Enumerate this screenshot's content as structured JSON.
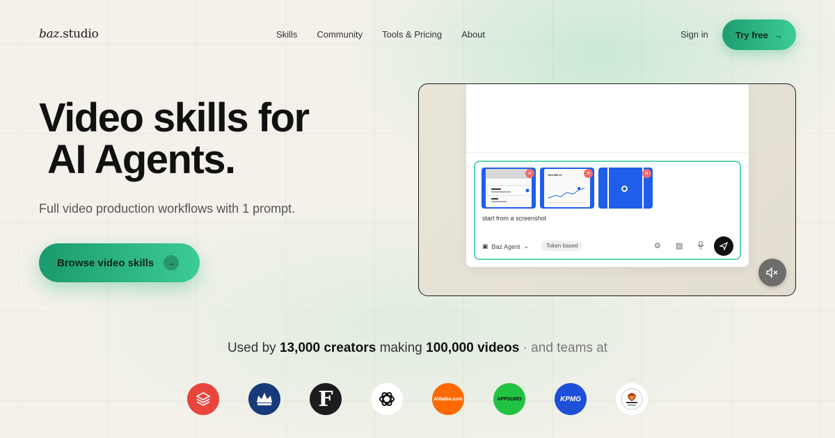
{
  "nav": {
    "logo_brand": "baz",
    "logo_suffix": ".studio",
    "menu": [
      "Skills",
      "Community",
      "Tools & Pricing",
      "About"
    ],
    "sign_in": "Sign in",
    "try_free": "Try free",
    "try_free_arrow": "→"
  },
  "hero": {
    "title_line1": "Video skills for",
    "title_line2": "AI Agents.",
    "subtitle": "Full video production workflows with 1 prompt.",
    "cta": "Browse video skills",
    "cta_arrow": "→"
  },
  "video": {
    "prompt_text": "start from a screenshot",
    "agent_label": "Baz Agent",
    "agent_chevron": "⌄",
    "token_chip": "Token based",
    "thumb_remove": "×",
    "thumb2_amount": "$23,450.17",
    "accent": "#1f5eea",
    "border_accent": "#5ed3b2"
  },
  "social": {
    "prefix": "Used by ",
    "creators": "13,000 creators",
    "middle": " making ",
    "videos": "100,000 videos",
    "suffix": " · and teams at",
    "logos": [
      {
        "name": "stack-logo",
        "bg": "#e8453c"
      },
      {
        "name": "crown-logo",
        "bg": "#173a7a"
      },
      {
        "name": "f-logo",
        "bg": "#1c1c1c",
        "text": "F"
      },
      {
        "name": "openai-logo",
        "bg": "#ffffff"
      },
      {
        "name": "alibaba-logo",
        "bg": "#ff6a00",
        "text": "Alibaba.com"
      },
      {
        "name": "appsumo-logo",
        "bg": "#22c343",
        "text": "APPSUMO"
      },
      {
        "name": "kpmg-logo",
        "bg": "#1e4fd8",
        "text": "KPMG"
      },
      {
        "name": "emblem-logo",
        "bg": "#ffffff"
      }
    ]
  }
}
